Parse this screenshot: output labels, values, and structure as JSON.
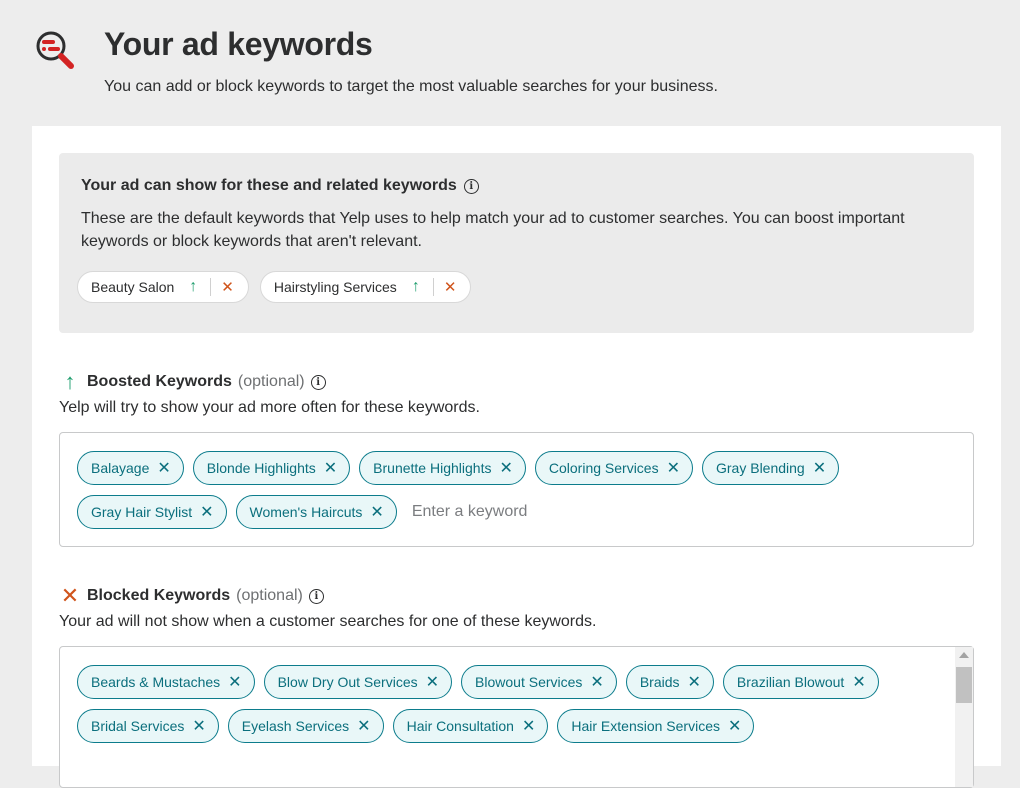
{
  "header": {
    "title": "Your ad keywords",
    "subtitle": "You can add or block keywords to target the most valuable searches for your business.",
    "icon": "keyword-search-icon"
  },
  "default_keywords": {
    "title": "Your ad can show for these and related keywords",
    "description": "These are the default keywords that Yelp uses to help match your ad to customer searches. You can boost important keywords or block keywords that aren't relevant.",
    "chips": [
      {
        "label": "Beauty Salon"
      },
      {
        "label": "Hairstyling Services"
      }
    ]
  },
  "boosted": {
    "title": "Boosted Keywords",
    "optional": "(optional)",
    "description": "Yelp will try to show your ad more often for these keywords.",
    "keywords": [
      "Balayage",
      "Blonde Highlights",
      "Brunette Highlights",
      "Coloring Services",
      "Gray Blending",
      "Gray Hair Stylist",
      "Women's Haircuts"
    ],
    "input_placeholder": "Enter a keyword"
  },
  "blocked": {
    "title": "Blocked Keywords",
    "optional": "(optional)",
    "description": "Your ad will not show when a customer searches for one of these keywords.",
    "keywords": [
      "Beards & Mustaches",
      "Blow Dry Out Services",
      "Blowout Services",
      "Braids",
      "Brazilian Blowout",
      "Bridal Services",
      "Eyelash Services",
      "Hair Consultation",
      "Hair Extension Services"
    ]
  },
  "colors": {
    "accent_teal": "#0c7c8c",
    "boost_green": "#1f9e6e",
    "block_red": "#d0541b",
    "brand_red": "#d32323"
  }
}
